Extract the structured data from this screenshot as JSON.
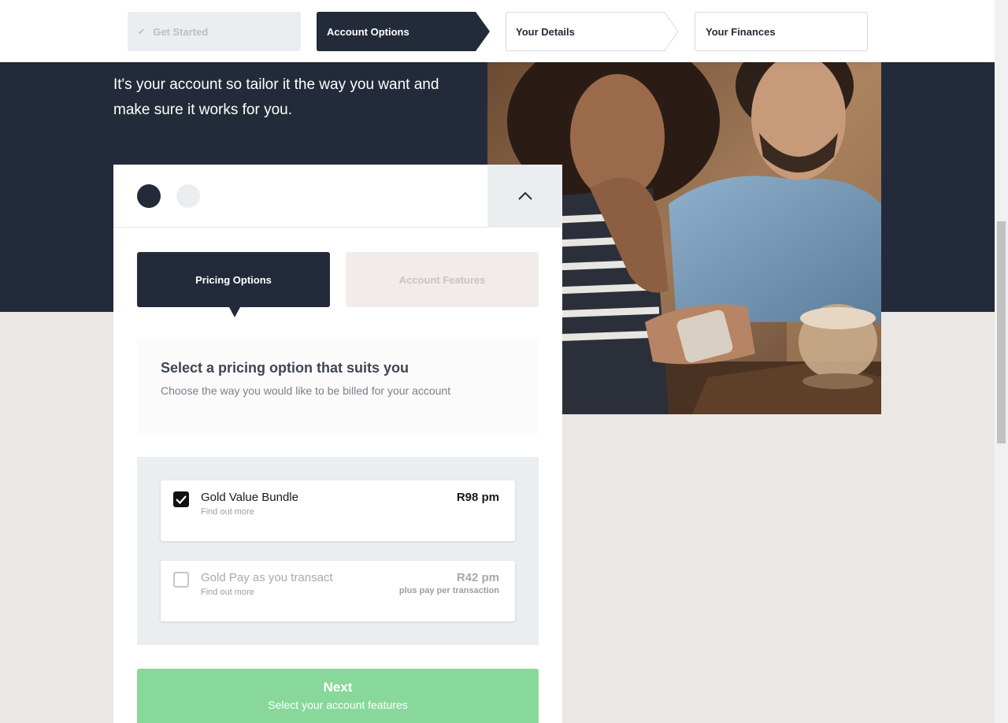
{
  "stepper": {
    "steps": [
      {
        "label": "Get Started",
        "state": "completed",
        "icon": "check-icon"
      },
      {
        "label": "Account Options",
        "state": "active"
      },
      {
        "label": "Your Details",
        "state": "upcoming"
      },
      {
        "label": "Your Finances",
        "state": "upcoming"
      }
    ]
  },
  "hero": {
    "text": "It's your account so tailor it the way you want and make sure it works for you."
  },
  "card": {
    "collapse_icon": "chevron-up-icon",
    "tabs": [
      {
        "label": "Pricing Options",
        "active": true
      },
      {
        "label": "Account Features",
        "active": false
      }
    ],
    "info": {
      "title": "Select a pricing option that suits you",
      "subtitle": "Choose the way you would like to be billed for your account"
    },
    "options": [
      {
        "name": "Gold Value Bundle",
        "link": "Find out more",
        "price": "R98 pm",
        "note": "",
        "checked": true
      },
      {
        "name": "Gold Pay as you transact",
        "link": "Find out more",
        "price": "R42 pm",
        "note": "plus pay per transaction",
        "checked": false
      }
    ],
    "next": {
      "title": "Next",
      "subtitle": "Select your account features"
    }
  },
  "colors": {
    "navy": "#232b3a",
    "next_green": "#88d89c",
    "page_bg": "#ebe7e4"
  }
}
